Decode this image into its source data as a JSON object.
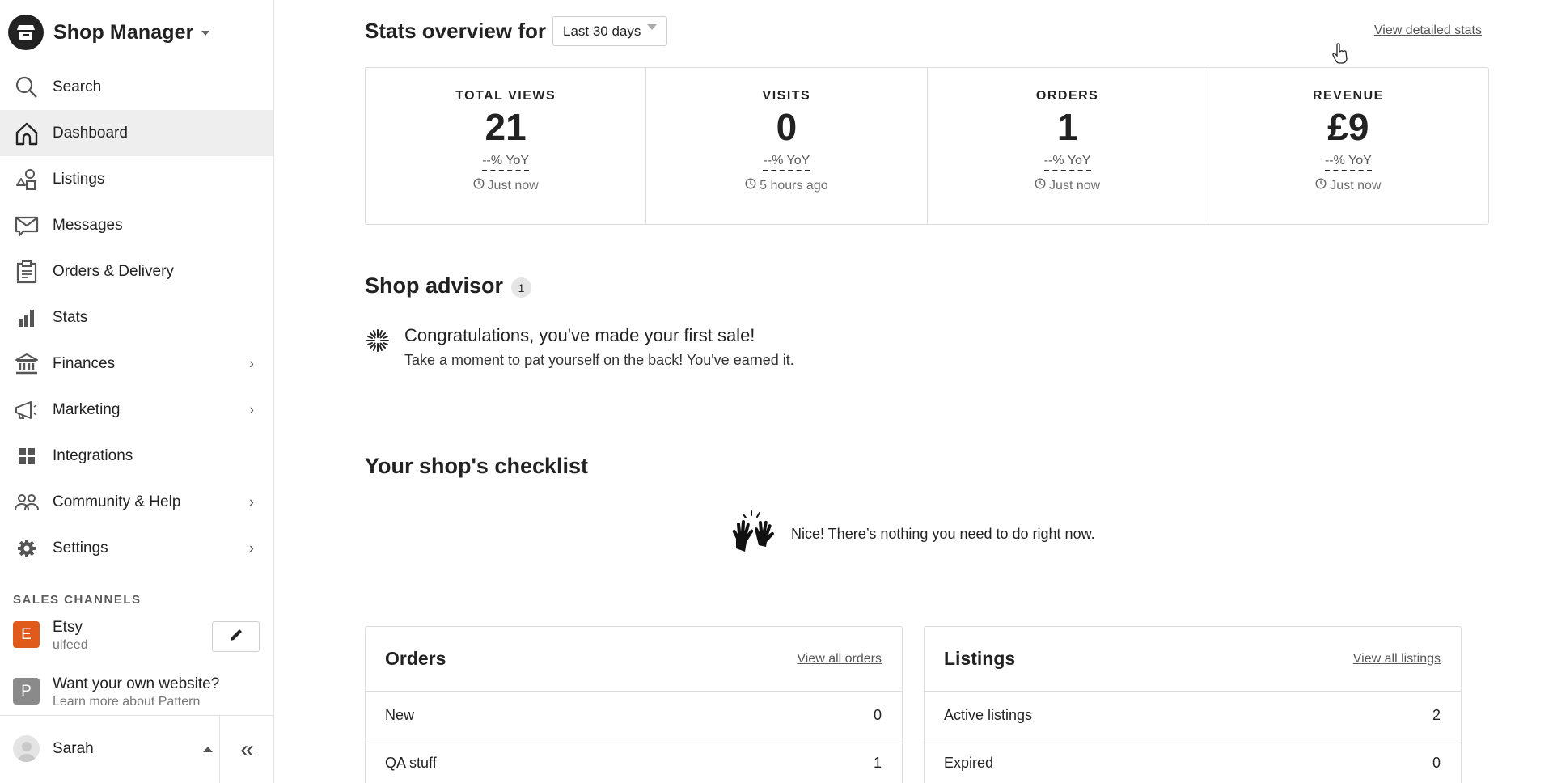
{
  "sidebar": {
    "brand": "Shop Manager",
    "nav": [
      {
        "label": "Search",
        "icon": "search-icon"
      },
      {
        "label": "Dashboard",
        "icon": "home-icon",
        "active": true
      },
      {
        "label": "Listings",
        "icon": "shapes-icon"
      },
      {
        "label": "Messages",
        "icon": "envelope-icon"
      },
      {
        "label": "Orders & Delivery",
        "icon": "clipboard-icon"
      },
      {
        "label": "Stats",
        "icon": "bar-chart-icon"
      },
      {
        "label": "Finances",
        "icon": "bank-icon",
        "chevron": true
      },
      {
        "label": "Marketing",
        "icon": "megaphone-icon",
        "chevron": true
      },
      {
        "label": "Integrations",
        "icon": "grid-icon"
      },
      {
        "label": "Community & Help",
        "icon": "people-icon",
        "chevron": true
      },
      {
        "label": "Settings",
        "icon": "gear-icon",
        "chevron": true
      }
    ],
    "sales_channels_heading": "SALES CHANNELS",
    "channels": [
      {
        "badge": "E",
        "title": "Etsy",
        "subtitle": "uifeed",
        "color": "#e05a1b"
      },
      {
        "badge": "P",
        "title": "Want your own website?",
        "subtitle": "Learn more about Pattern",
        "color": "#8a8a8a"
      }
    ],
    "user": "Sarah",
    "chevron_glyph": "›",
    "collapse_glyph": "«"
  },
  "main": {
    "stats_title": "Stats overview for",
    "range": "Last 30 days",
    "view_stats": "View detailed stats",
    "stats": [
      {
        "label": "TOTAL VIEWS",
        "value": "21",
        "yoy": "--% YoY",
        "time": "Just now"
      },
      {
        "label": "VISITS",
        "value": "0",
        "yoy": "--% YoY",
        "time": "5 hours ago"
      },
      {
        "label": "ORDERS",
        "value": "1",
        "yoy": "--% YoY",
        "time": "Just now"
      },
      {
        "label": "REVENUE",
        "value": "£9",
        "yoy": "--% YoY",
        "time": "Just now"
      }
    ],
    "advisor": {
      "title": "Shop advisor",
      "count": "1",
      "item_title": "Congratulations, you've made your first sale!",
      "item_sub": "Take a moment to pat yourself on the back! You've earned it."
    },
    "checklist": {
      "title": "Your shop's checklist",
      "message": "Nice! There’s nothing you need to do right now."
    },
    "orders": {
      "title": "Orders",
      "link": "View all orders",
      "rows": [
        {
          "label": "New",
          "value": "0"
        },
        {
          "label": "QA stuff",
          "value": "1"
        }
      ]
    },
    "listings": {
      "title": "Listings",
      "link": "View all listings",
      "rows": [
        {
          "label": "Active listings",
          "value": "2"
        },
        {
          "label": "Expired",
          "value": "0"
        }
      ]
    }
  }
}
